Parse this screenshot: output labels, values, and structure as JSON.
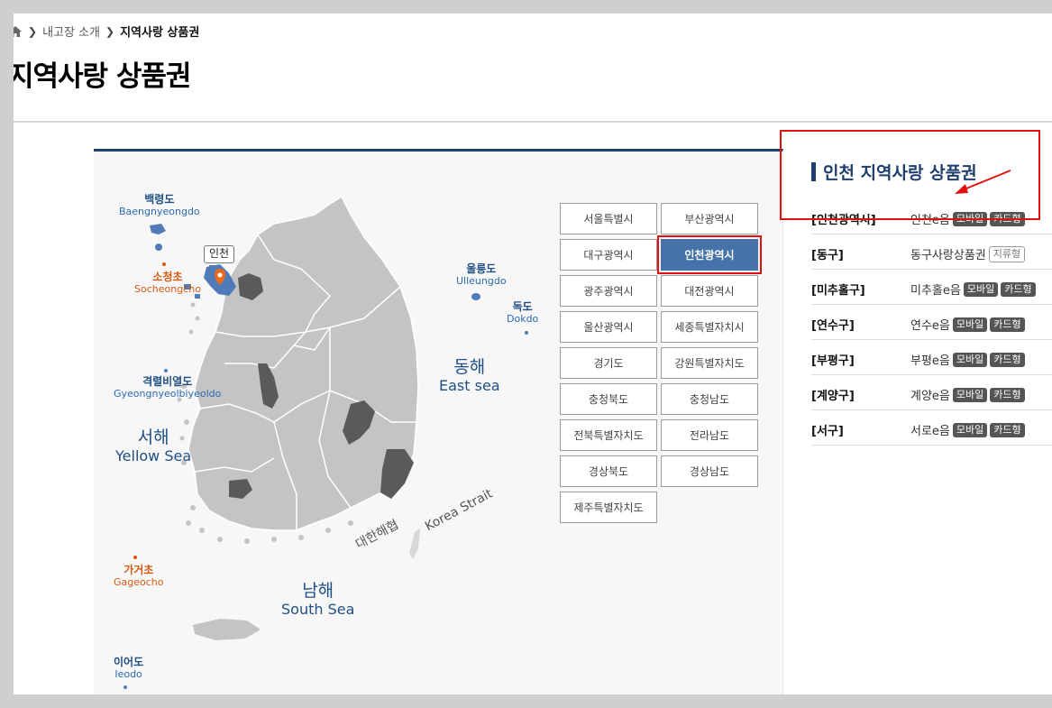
{
  "breadcrumb": {
    "items": [
      "내고장 소개",
      "지역사랑 상품권"
    ]
  },
  "page_title": "지역사랑 상품권",
  "map": {
    "islands": [
      {
        "ko": "백령도",
        "en": "Baengnyeongdo"
      },
      {
        "ko": "소청초",
        "en": "Socheongcho"
      },
      {
        "ko": "울릉도",
        "en": "Ulleungdo"
      },
      {
        "ko": "독도",
        "en": "Dokdo"
      },
      {
        "ko": "격렬비열도",
        "en": "Gyeongnyeolbiyeoldo"
      },
      {
        "ko": "가거초",
        "en": "Gageocho"
      },
      {
        "ko": "이어도",
        "en": "Ieodo"
      }
    ],
    "seas": {
      "west": {
        "ko": "서해",
        "en": "Yellow Sea"
      },
      "east": {
        "ko": "동해",
        "en": "East sea"
      },
      "south": {
        "ko": "남해",
        "en": "South Sea"
      },
      "strait_ko": "대한해협",
      "strait_en": "Korea Strait"
    },
    "marker_label": "인천",
    "colors": {
      "land": "#c4c4c4",
      "region_selected": "#4f7bb8",
      "highlight": "#5a5a5a",
      "marker": "#ee6a1a"
    }
  },
  "regions": [
    {
      "label": "서울특별시",
      "active": false
    },
    {
      "label": "부산광역시",
      "active": false
    },
    {
      "label": "대구광역시",
      "active": false
    },
    {
      "label": "인천광역시",
      "active": true
    },
    {
      "label": "광주광역시",
      "active": false
    },
    {
      "label": "대전광역시",
      "active": false
    },
    {
      "label": "울산광역시",
      "active": false
    },
    {
      "label": "세종특별자치시",
      "active": false
    },
    {
      "label": "경기도",
      "active": false
    },
    {
      "label": "강원특별자치도",
      "active": false
    },
    {
      "label": "충청북도",
      "active": false
    },
    {
      "label": "충청남도",
      "active": false
    },
    {
      "label": "전북특별자치도",
      "active": false
    },
    {
      "label": "전라남도",
      "active": false
    },
    {
      "label": "경상북도",
      "active": false
    },
    {
      "label": "경상남도",
      "active": false
    },
    {
      "label": "제주특별자치도",
      "active": false
    }
  ],
  "sidebar": {
    "title": "인천 지역사랑 상품권",
    "rows": [
      {
        "district": "[인천광역시]",
        "voucher": "인천e음",
        "tags": [
          "모바일",
          "카드형"
        ]
      },
      {
        "district": "[동구]",
        "voucher": "동구사랑상품권",
        "tags": [
          "지류형"
        ]
      },
      {
        "district": "[미추홀구]",
        "voucher": "미추홀e음",
        "tags": [
          "모바일",
          "카드형"
        ]
      },
      {
        "district": "[연수구]",
        "voucher": "연수e음",
        "tags": [
          "모바일",
          "카드형"
        ]
      },
      {
        "district": "[부평구]",
        "voucher": "부평e음",
        "tags": [
          "모바일",
          "카드형"
        ]
      },
      {
        "district": "[계양구]",
        "voucher": "계양e음",
        "tags": [
          "모바일",
          "카드형"
        ]
      },
      {
        "district": "[서구]",
        "voucher": "서로e음",
        "tags": [
          "모바일",
          "카드형"
        ]
      }
    ]
  },
  "annotation_color": "#e01010"
}
